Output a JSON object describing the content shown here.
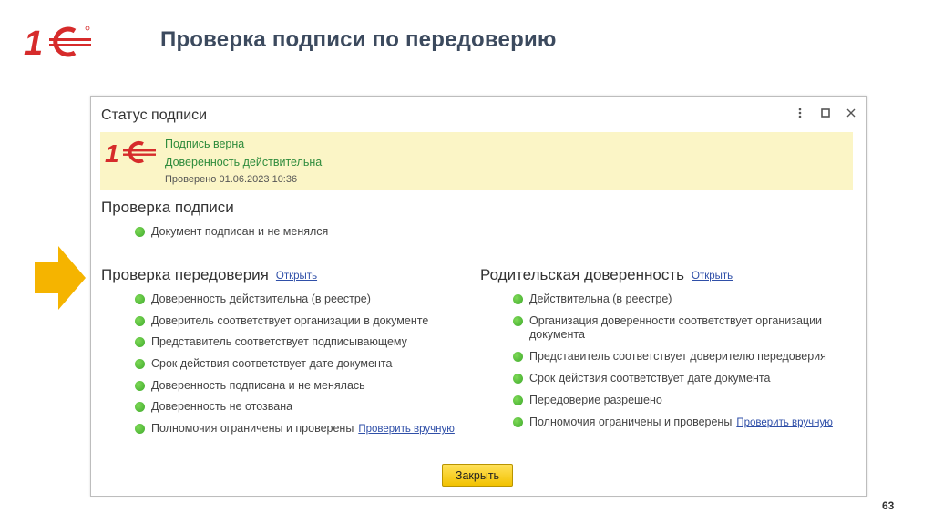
{
  "slide": {
    "title": "Проверка подписи по передоверию",
    "page_number": "63",
    "brand_logo": "1C-logo",
    "accent_color": "#d62b2b",
    "arrow_color": "#f5b400"
  },
  "dialog": {
    "title": "Статус подписи",
    "controls": [
      "more-icon",
      "maximize-icon",
      "close-icon"
    ],
    "banner": {
      "line1": "Подпись верна",
      "line2": "Доверенность действительна",
      "line3": "Проверено 01.06.2023 10:36",
      "status_color": "#2e8b3c",
      "background": "#fbf5c6"
    },
    "signature_check": {
      "title": "Проверка подписи",
      "items": [
        {
          "label": "Документ подписан и не менялся"
        }
      ]
    },
    "delegation_check": {
      "title": "Проверка передоверия",
      "link": "Открыть",
      "items": [
        {
          "label": "Доверенность действительна (в реестре)"
        },
        {
          "label": "Доверитель соответствует организации в документе"
        },
        {
          "label": "Представитель соответствует подписывающему"
        },
        {
          "label": "Срок действия соответствует дате документа"
        },
        {
          "label": "Доверенность подписана и не менялась"
        },
        {
          "label": "Доверенность не отозвана"
        },
        {
          "label": "Полномочия ограничены и проверены",
          "link": "Проверить вручную"
        }
      ]
    },
    "parent_power": {
      "title": "Родительская доверенность",
      "link": "Открыть",
      "items": [
        {
          "label": "Действительна (в реестре)"
        },
        {
          "label": "Организация доверенности соответствует организации документа"
        },
        {
          "label": "Представитель соответствует доверителю передоверия"
        },
        {
          "label": "Срок действия соответствует дате документа"
        },
        {
          "label": "Передоверие разрешено"
        },
        {
          "label": "Полномочия ограничены и проверены",
          "link": "Проверить вручную"
        }
      ]
    },
    "close_label": "Закрыть"
  }
}
